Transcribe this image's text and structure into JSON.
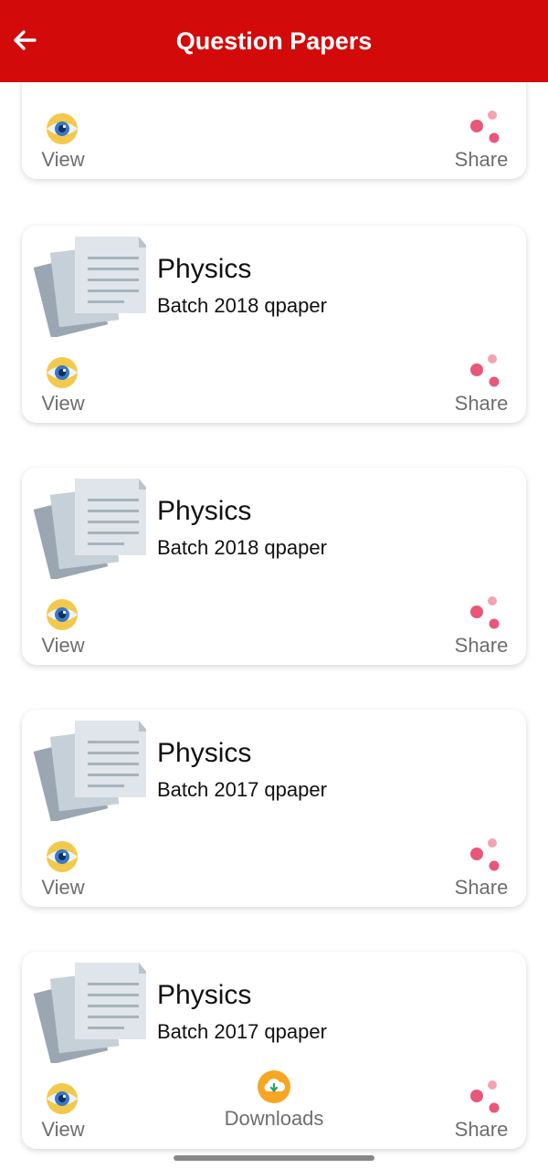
{
  "header": {
    "title": "Question Papers",
    "back_icon": "arrow-left-icon"
  },
  "colors": {
    "appbar": "#d20a0a",
    "eye_outer": "#f2c94c",
    "eye_iris": "#3a78c8",
    "share": "#e8577a",
    "download": "#f5a623"
  },
  "items": [
    {
      "title": "",
      "subtitle": "",
      "view_label": "View",
      "share_label": "Share"
    },
    {
      "title": "Physics",
      "subtitle": "Batch 2018 qpaper",
      "view_label": "View",
      "share_label": "Share"
    },
    {
      "title": "Physics",
      "subtitle": "Batch 2018 qpaper",
      "view_label": "View",
      "share_label": "Share"
    },
    {
      "title": "Physics",
      "subtitle": "Batch 2017 qpaper",
      "view_label": "View",
      "share_label": "Share"
    },
    {
      "title": "Physics",
      "subtitle": "Batch 2017 qpaper",
      "view_label": "View",
      "share_label": "Share"
    }
  ],
  "downloads": {
    "label": "Downloads",
    "icon": "cloud-download-icon"
  }
}
